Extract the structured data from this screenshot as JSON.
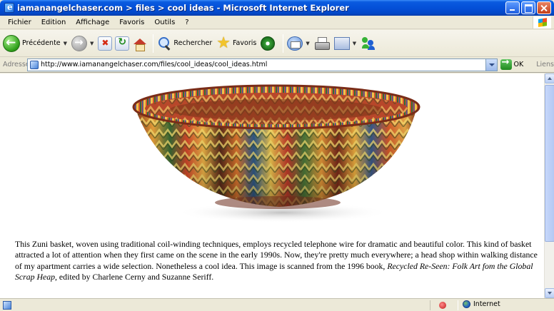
{
  "window": {
    "title": "iamanangelchaser.com > files > cool ideas - Microsoft Internet Explorer"
  },
  "menu": {
    "items": [
      "Fichier",
      "Edition",
      "Affichage",
      "Favoris",
      "Outils",
      "?"
    ]
  },
  "toolbar": {
    "back_label": "Précédente",
    "search_label": "Rechercher",
    "favorites_label": "Favoris"
  },
  "address": {
    "label": "Adresse",
    "url": "http://www.iamanangelchaser.com/files/cool_ideas/cool_ideas.html",
    "go_label": "OK",
    "links_label": "Liens"
  },
  "article": {
    "text_before": "This Zuni basket, woven using traditional coil-winding techniques, employs recycled telephone wire for dramatic and beautiful color. This kind of basket attracted a lot of attention when they first came on the scene in the early 1990s. Now, they're pretty much everywhere; a head shop within walking distance of my apartment carries a wide selection. Nonetheless a cool idea. This image is scanned from the 1996 book, ",
    "book_title": "Recycled Re-Seen: Folk Art fom the Global Scrap Heap",
    "text_after": ", edited by Charlene Cerny and Suzanne Seriff."
  },
  "status": {
    "zone": "Internet"
  },
  "icons": {
    "back": "back-arrow-icon",
    "forward": "forward-arrow-icon",
    "stop": "stop-icon",
    "refresh": "refresh-icon",
    "home": "home-icon",
    "search": "search-icon",
    "favorites": "star-icon",
    "media": "media-icon",
    "mail": "mail-icon",
    "print": "print-icon",
    "edit": "edit-icon",
    "messenger": "messenger-icon"
  }
}
